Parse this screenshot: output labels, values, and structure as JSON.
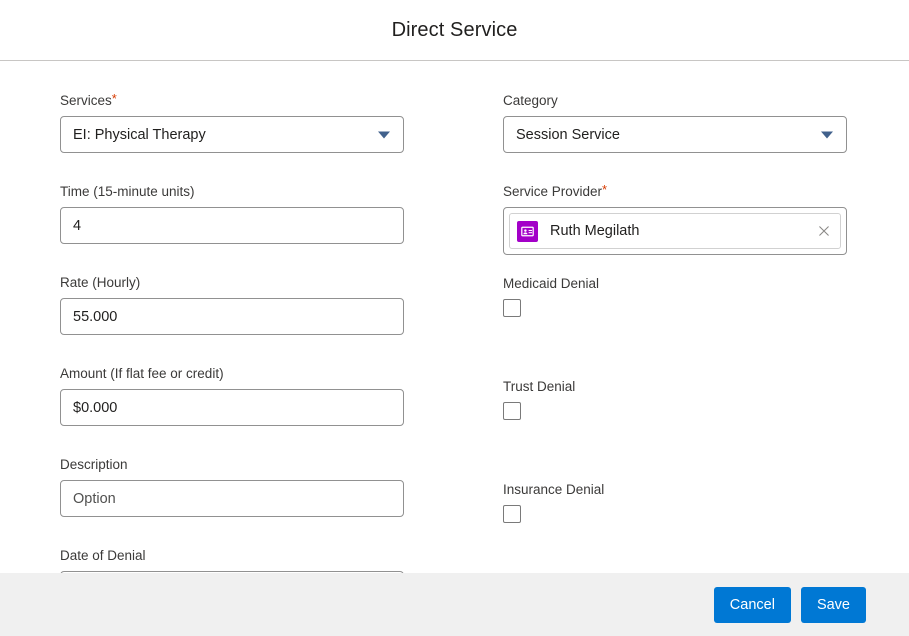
{
  "dialog": {
    "title": "Direct Service"
  },
  "form": {
    "left_column": [
      {
        "name": "services",
        "label": "Services",
        "required": true,
        "type": "select",
        "value": "EI: Physical Therapy"
      },
      {
        "name": "time-units",
        "label": "Time (15-minute units)",
        "required": false,
        "type": "text",
        "value": "4"
      },
      {
        "name": "rate-hourly",
        "label": "Rate (Hourly)",
        "required": false,
        "type": "text",
        "value": "55.000"
      },
      {
        "name": "amount",
        "label": "Amount (If flat fee or credit)",
        "required": false,
        "type": "text",
        "value": "$0.000"
      },
      {
        "name": "description",
        "label": "Description",
        "required": false,
        "type": "text",
        "value": "Option"
      },
      {
        "name": "date-of-denial",
        "label": "Date of Denial",
        "required": false,
        "type": "date",
        "value": ""
      }
    ],
    "right_column": {
      "category": {
        "label": "Category",
        "required": false,
        "value": "Session Service"
      },
      "service_provider": {
        "label": "Service Provider",
        "required": true,
        "person_name": "Ruth Megilath",
        "avatar_icon": "contact-card-icon",
        "avatar_color": "#a300c8",
        "remove_icon": "close-icon"
      },
      "checkboxes": [
        {
          "name": "medicaid-denial",
          "label": "Medicaid Denial",
          "checked": false
        },
        {
          "name": "trust-denial",
          "label": "Trust Denial",
          "checked": false
        },
        {
          "name": "insurance-denial",
          "label": "Insurance Denial",
          "checked": false
        }
      ]
    }
  },
  "footer": {
    "cancel_label": "Cancel",
    "save_label": "Save"
  },
  "icons": {
    "chevron": "chevron-down-icon",
    "calendar": "calendar-icon"
  },
  "colors": {
    "accent": "#0078d4",
    "required_asterisk": "#d83b01",
    "avatar_purple": "#a300c8",
    "chevron_blue": "#41618c",
    "calendar_blue": "#4a6894",
    "footer_bg": "#f0f0f0"
  }
}
